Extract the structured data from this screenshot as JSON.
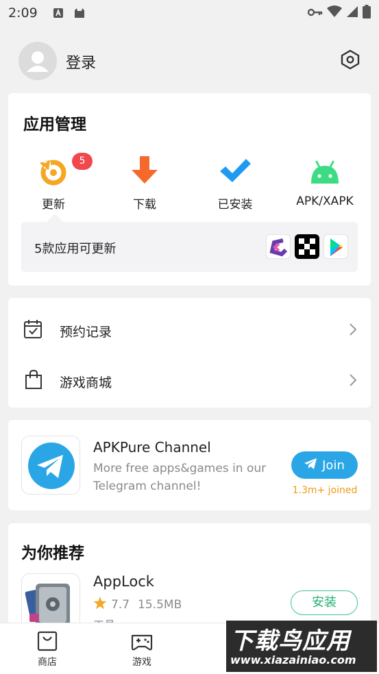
{
  "status_bar": {
    "time": "2:09"
  },
  "profile": {
    "login_label": "登录"
  },
  "app_management": {
    "title": "应用管理",
    "items": [
      {
        "label": "更新",
        "icon": "update-icon",
        "badge": "5"
      },
      {
        "label": "下载",
        "icon": "download-icon"
      },
      {
        "label": "已安装",
        "icon": "installed-check-icon"
      },
      {
        "label": "APK/XAPK",
        "icon": "android-icon"
      }
    ],
    "update_summary": "5款应用可更新"
  },
  "menu": {
    "items": [
      {
        "label": "预约记录",
        "icon": "calendar-check-icon"
      },
      {
        "label": "游戏商城",
        "icon": "shopping-bag-icon"
      }
    ]
  },
  "telegram": {
    "title": "APKPure Channel",
    "description": "More free apps&games in our Telegram channel!",
    "join_label": "Join",
    "joined_count": "1.3m+ joined"
  },
  "recommend": {
    "title": "为你推荐",
    "app": {
      "name": "AppLock",
      "rating": "7.7",
      "size": "15.5MB",
      "category": "工具",
      "install_label": "安装"
    }
  },
  "bottom_nav": {
    "items": [
      {
        "label": "商店",
        "icon": "store-icon"
      },
      {
        "label": "游戏",
        "icon": "gamepad-icon"
      }
    ]
  },
  "watermark": {
    "title": "下载鸟应用",
    "url": "www.xiazainiao.com"
  },
  "colors": {
    "accent_orange": "#f5a623",
    "download_orange": "#f5692c",
    "check_blue": "#1e9bf0",
    "android_green": "#3ddc84",
    "badge_red": "#f0484c",
    "telegram_blue": "#2aa6e6",
    "install_green": "#23b073"
  }
}
